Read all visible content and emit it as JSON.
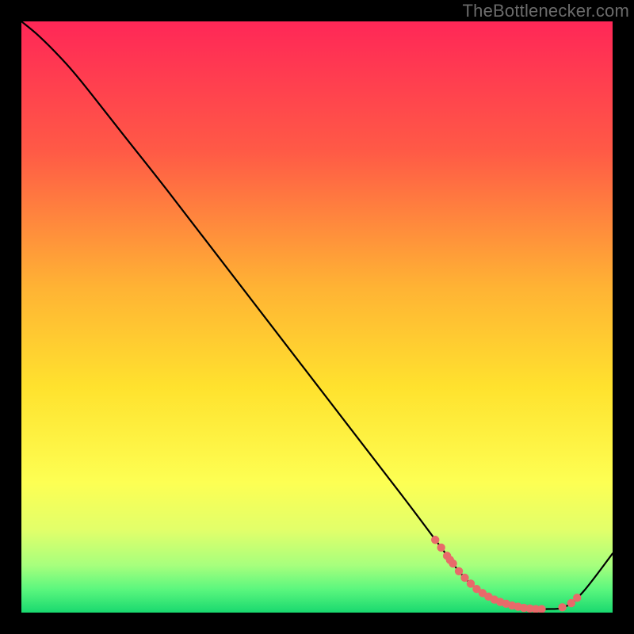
{
  "watermark": "TheBottlenecker.com",
  "chart_data": {
    "type": "line",
    "title": "",
    "xlabel": "",
    "ylabel": "",
    "xlim": [
      0,
      100
    ],
    "ylim": [
      0,
      100
    ],
    "grid": false,
    "legend": false,
    "background_gradient_stops": [
      {
        "offset": 0.0,
        "color": "#ff2757"
      },
      {
        "offset": 0.22,
        "color": "#ff5a46"
      },
      {
        "offset": 0.45,
        "color": "#ffb334"
      },
      {
        "offset": 0.62,
        "color": "#ffe22e"
      },
      {
        "offset": 0.78,
        "color": "#fdff53"
      },
      {
        "offset": 0.86,
        "color": "#e2ff6a"
      },
      {
        "offset": 0.92,
        "color": "#a7ff7d"
      },
      {
        "offset": 0.96,
        "color": "#5cf77e"
      },
      {
        "offset": 1.0,
        "color": "#19d96f"
      }
    ],
    "series": [
      {
        "name": "bottleneck-curve",
        "x": [
          0.0,
          3.0,
          6.5,
          10.0,
          17.5,
          25.0,
          35.0,
          45.0,
          55.0,
          65.0,
          71.0,
          74.0,
          77.0,
          80.0,
          83.0,
          86.0,
          89.0,
          92.0,
          95.0,
          100.0
        ],
        "y": [
          100.0,
          97.5,
          94.0,
          90.0,
          80.5,
          71.0,
          58.0,
          45.0,
          32.0,
          19.0,
          11.0,
          7.0,
          4.0,
          2.2,
          1.2,
          0.7,
          0.6,
          1.0,
          3.5,
          10.0
        ]
      }
    ],
    "markers": {
      "name": "highlighted-x-range-dots",
      "xy": [
        [
          70.0,
          12.3
        ],
        [
          71.0,
          11.0
        ],
        [
          72.0,
          9.6
        ],
        [
          72.5,
          8.9
        ],
        [
          73.0,
          8.3
        ],
        [
          74.0,
          7.0
        ],
        [
          75.0,
          5.9
        ],
        [
          76.0,
          4.9
        ],
        [
          77.0,
          4.0
        ],
        [
          78.0,
          3.3
        ],
        [
          79.0,
          2.7
        ],
        [
          80.0,
          2.2
        ],
        [
          81.0,
          1.8
        ],
        [
          82.0,
          1.5
        ],
        [
          83.0,
          1.2
        ],
        [
          84.0,
          1.0
        ],
        [
          85.0,
          0.8
        ],
        [
          86.0,
          0.7
        ],
        [
          87.0,
          0.6
        ],
        [
          88.0,
          0.6
        ],
        [
          91.5,
          0.9
        ],
        [
          93.0,
          1.6
        ],
        [
          94.0,
          2.5
        ]
      ],
      "r": 5.2
    }
  }
}
